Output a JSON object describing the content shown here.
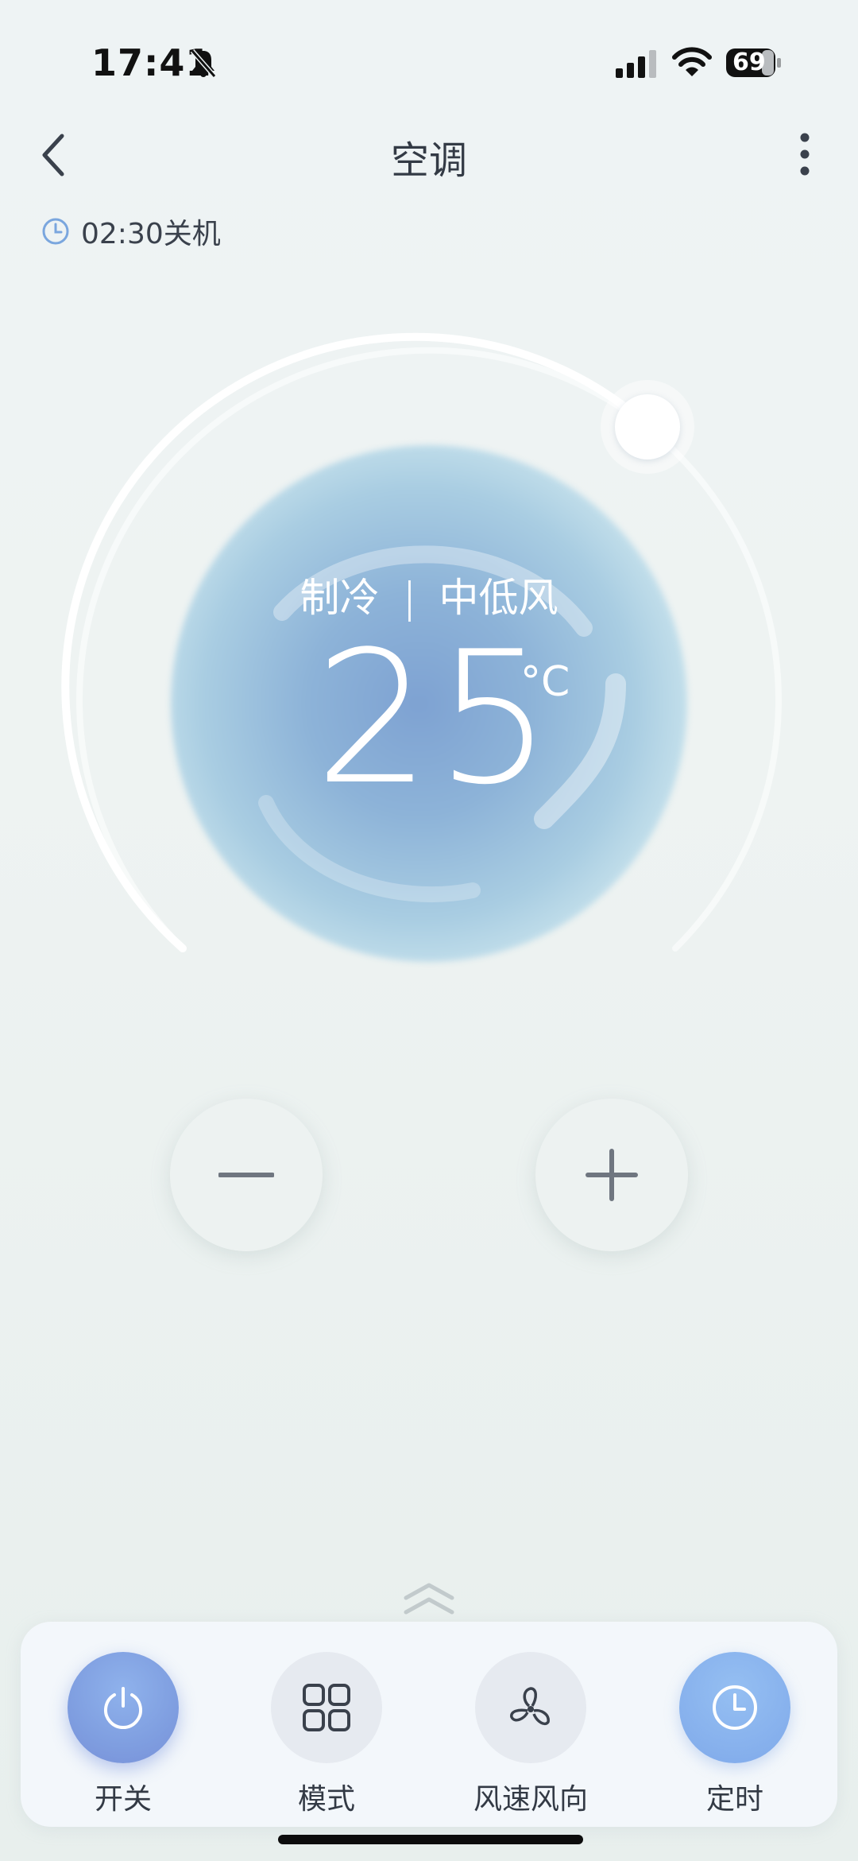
{
  "status_bar": {
    "time": "17:41",
    "battery": "69",
    "icons": [
      "bell-slash-icon",
      "cellular-signal-icon",
      "wifi-icon",
      "battery-icon"
    ]
  },
  "header": {
    "title": "空调",
    "back_icon": "chevron-left-icon",
    "more_icon": "more-vertical-icon"
  },
  "timer": {
    "icon": "clock-icon",
    "text": "02:30关机"
  },
  "dial": {
    "mode": "制冷",
    "fan": "中低风",
    "temperature": "25",
    "unit": "°C"
  },
  "controls": {
    "minus_icon": "minus-icon",
    "plus_icon": "plus-icon",
    "expand_icon": "double-chevron-up-icon"
  },
  "toolbar": {
    "items": [
      {
        "label": "开关",
        "icon": "power-icon"
      },
      {
        "label": "模式",
        "icon": "grid-icon"
      },
      {
        "label": "风速风向",
        "icon": "fan-icon"
      },
      {
        "label": "定时",
        "icon": "clock-icon"
      }
    ]
  },
  "colors": {
    "accent_blue": "#7f9ee0",
    "timer_blue": "#7fa9ea",
    "text_dark": "#333a45"
  }
}
